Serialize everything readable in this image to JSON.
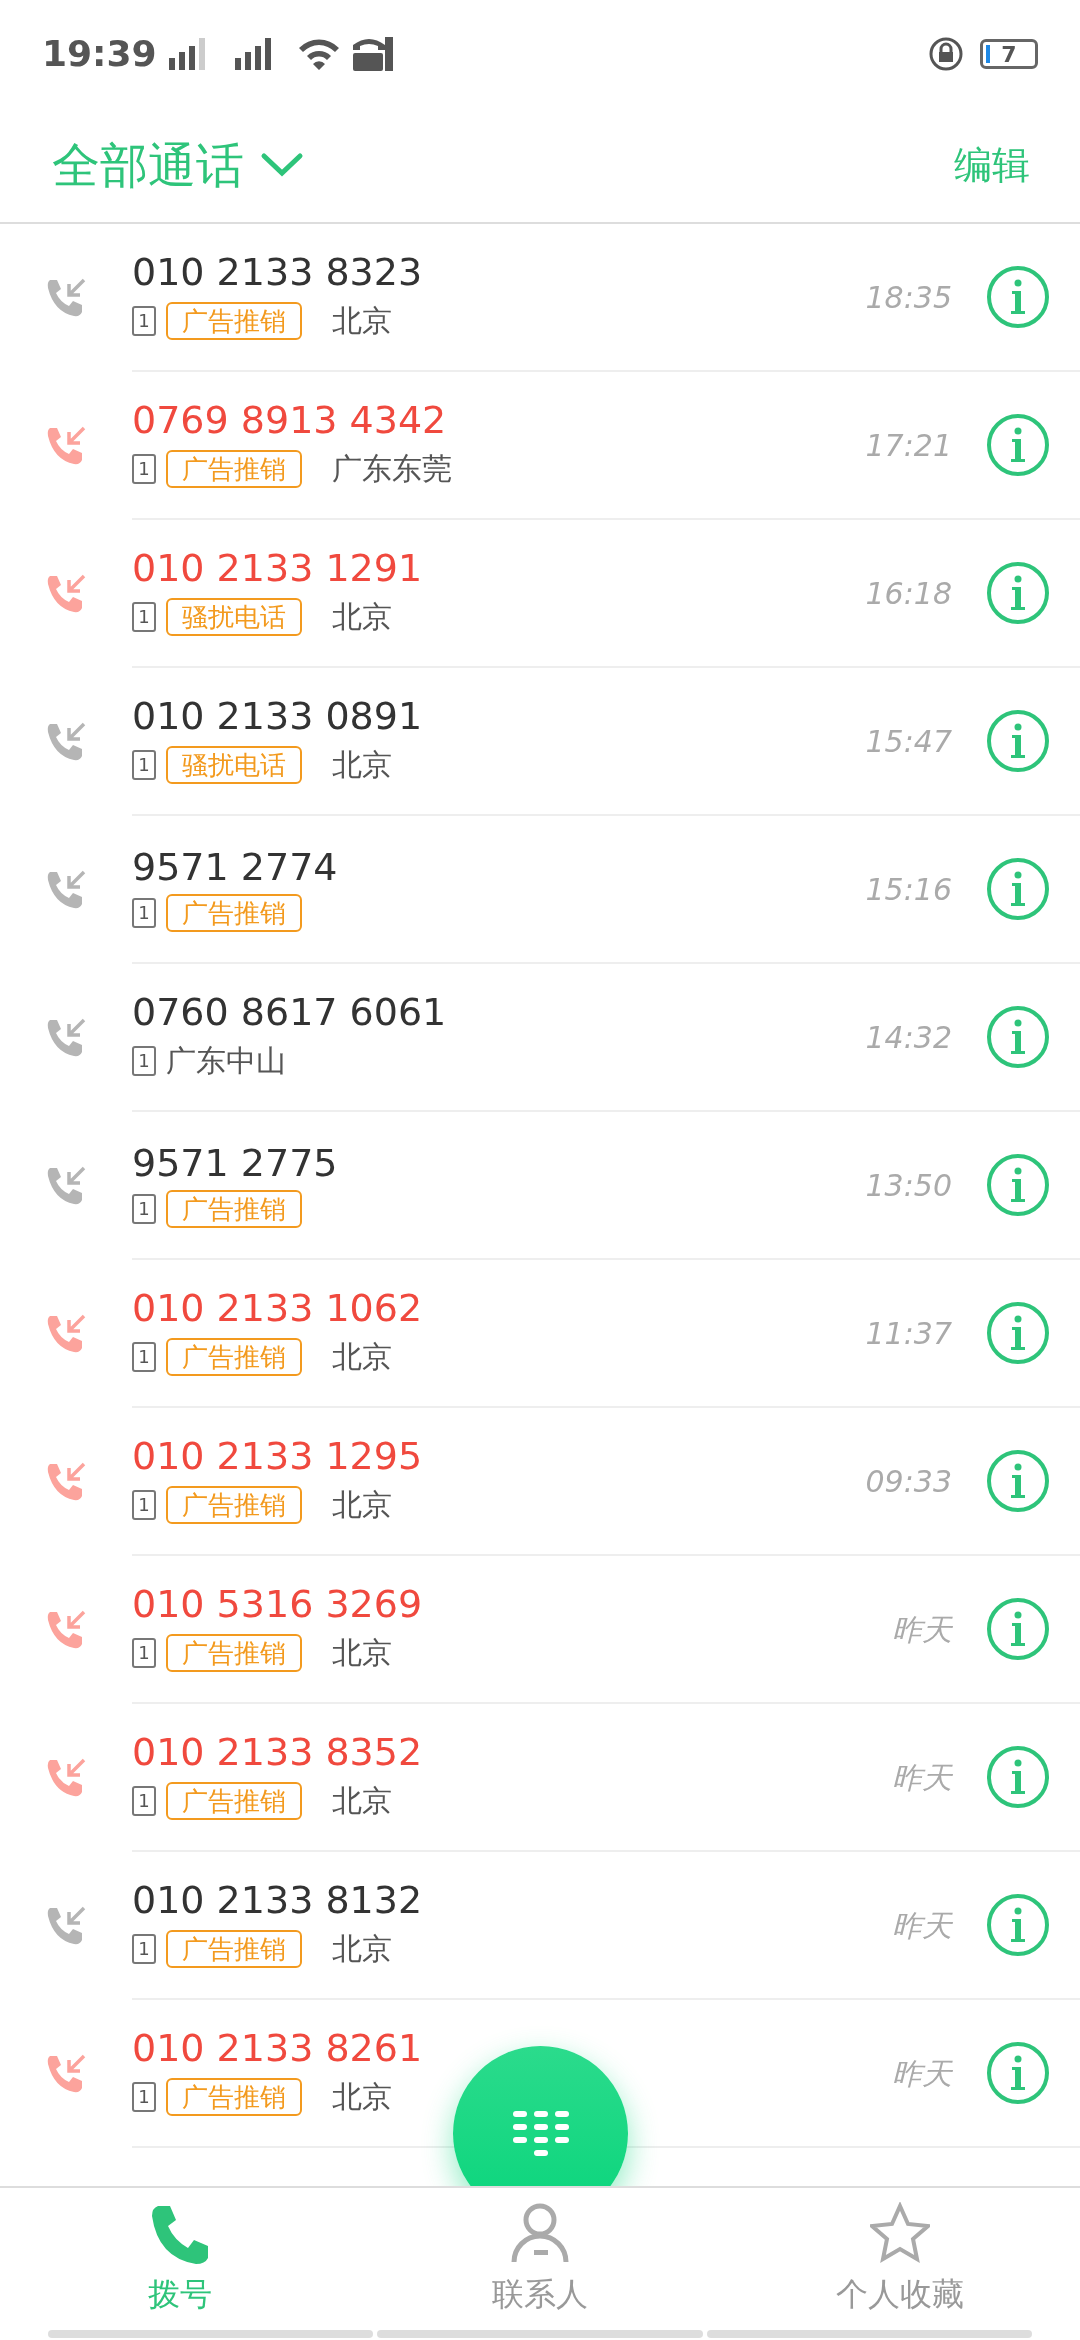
{
  "status_bar": {
    "time": "19:39",
    "battery": "7"
  },
  "header": {
    "title": "全部通话",
    "action": "编辑"
  },
  "calls": [
    {
      "number": "010 2133 8323",
      "missed": false,
      "sim": "1",
      "tag": "广告推销",
      "location": "北京",
      "time": "18:35"
    },
    {
      "number": "0769 8913 4342",
      "missed": true,
      "sim": "1",
      "tag": "广告推销",
      "location": "广东东莞",
      "time": "17:21"
    },
    {
      "number": "010 2133 1291",
      "missed": true,
      "sim": "1",
      "tag": "骚扰电话",
      "location": "北京",
      "time": "16:18"
    },
    {
      "number": "010 2133 0891",
      "missed": false,
      "sim": "1",
      "tag": "骚扰电话",
      "location": "北京",
      "time": "15:47"
    },
    {
      "number": "9571 2774",
      "missed": false,
      "sim": "1",
      "tag": "广告推销",
      "time": "15:16"
    },
    {
      "number": "0760 8617 6061",
      "missed": false,
      "sim": "1",
      "location": "广东中山",
      "time": "14:32"
    },
    {
      "number": "9571 2775",
      "missed": false,
      "sim": "1",
      "tag": "广告推销",
      "time": "13:50"
    },
    {
      "number": "010 2133 1062",
      "missed": true,
      "sim": "1",
      "tag": "广告推销",
      "location": "北京",
      "time": "11:37"
    },
    {
      "number": "010 2133 1295",
      "missed": true,
      "sim": "1",
      "tag": "广告推销",
      "location": "北京",
      "time": "09:33"
    },
    {
      "number": "010 5316 3269",
      "missed": true,
      "sim": "1",
      "tag": "广告推销",
      "location": "北京",
      "time": "昨天"
    },
    {
      "number": "010 2133 8352",
      "missed": true,
      "sim": "1",
      "tag": "广告推销",
      "location": "北京",
      "time": "昨天"
    },
    {
      "number": "010 2133 8132",
      "missed": false,
      "sim": "1",
      "tag": "广告推销",
      "location": "北京",
      "time": "昨天"
    },
    {
      "number": "010 2133 8261",
      "missed": true,
      "sim": "1",
      "tag": "广告推销",
      "location": "北京",
      "time": "昨天"
    }
  ],
  "bottom_nav": [
    {
      "label": "拨号",
      "selected": true,
      "kind": "phone"
    },
    {
      "label": "联系人",
      "selected": false,
      "kind": "person"
    },
    {
      "label": "个人收藏",
      "selected": false,
      "kind": "star"
    }
  ]
}
